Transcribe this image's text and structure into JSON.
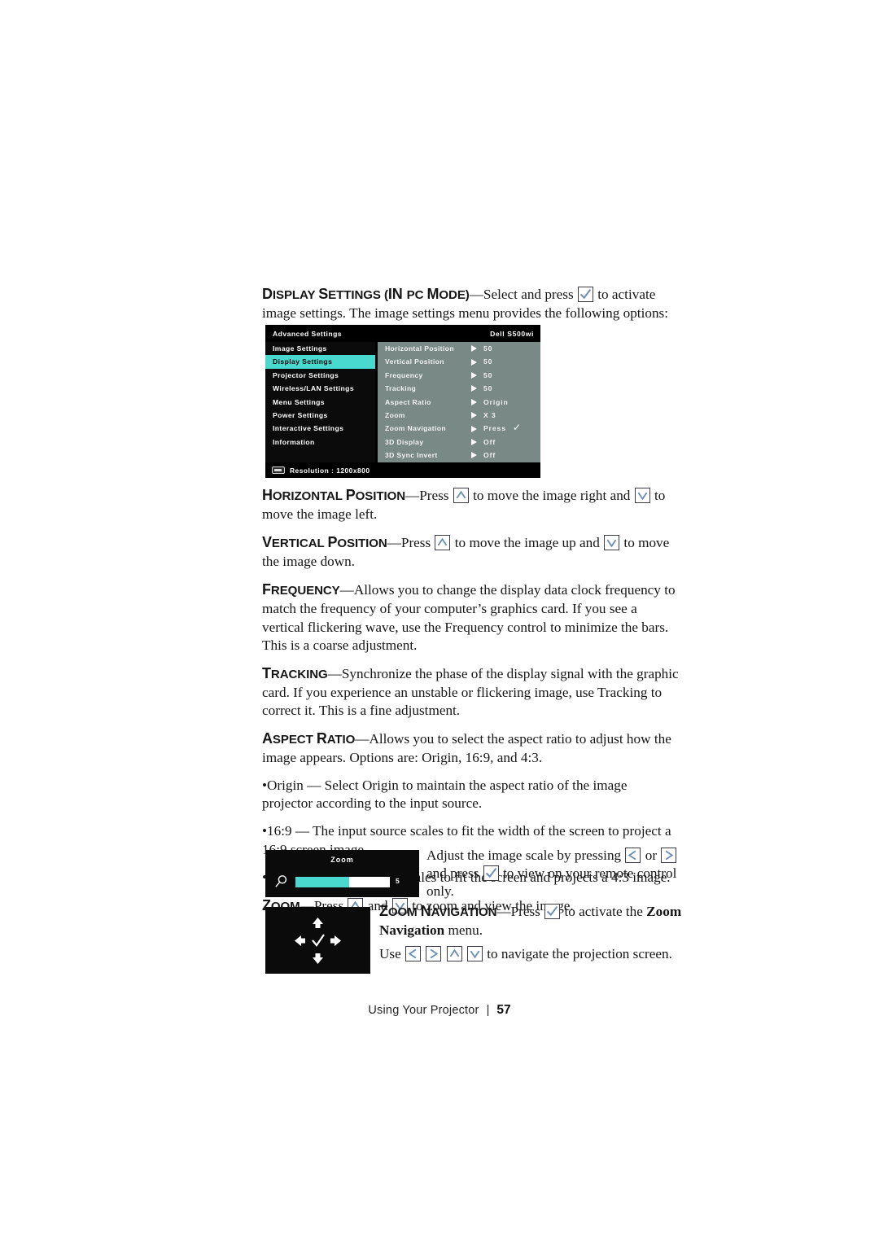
{
  "page": {
    "footer_chapter": "Using Your Projector",
    "footer_separator": "|",
    "footer_page_number": "57"
  },
  "intro": {
    "term_lead": "D",
    "term_rest": "ISPLAY ",
    "term_lead2": "S",
    "term_rest2": "ETTINGS (",
    "term_lead3": "IN ",
    "term_rest3": "PC M",
    "term_rest4": "ODE)",
    "term_full": "DISPLAY SETTINGS (IN PC MODE)",
    "text_before_key": "—Select and press",
    "text_after_key": "to activate image settings. The image settings menu provides the following options:"
  },
  "osd": {
    "title": "Advanced Settings",
    "model": "Dell  S500wi",
    "left_items": [
      {
        "label": "Image Settings",
        "selected": false
      },
      {
        "label": "Display Settings",
        "selected": true
      },
      {
        "label": "Projector Settings",
        "selected": false
      },
      {
        "label": "Wireless/LAN Settings",
        "selected": false
      },
      {
        "label": "Menu Settings",
        "selected": false
      },
      {
        "label": "Power Settings",
        "selected": false
      },
      {
        "label": "Interactive Settings",
        "selected": false
      },
      {
        "label": "Information",
        "selected": false
      }
    ],
    "rows": [
      {
        "label": "Horizontal Position",
        "value": "50",
        "check": ""
      },
      {
        "label": "Vertical Position",
        "value": "50",
        "check": ""
      },
      {
        "label": "Frequency",
        "value": "50",
        "check": ""
      },
      {
        "label": "Tracking",
        "value": "50",
        "check": ""
      },
      {
        "label": "Aspect Ratio",
        "value": "Origin",
        "check": ""
      },
      {
        "label": "Zoom",
        "value": "X 3",
        "check": ""
      },
      {
        "label": "Zoom Navigation",
        "value": "Press",
        "check": "✓"
      },
      {
        "label": "3D Display",
        "value": "Off",
        "check": ""
      },
      {
        "label": "3D Sync Invert",
        "value": "Off",
        "check": ""
      }
    ],
    "footer_label": "Resolution : 1200x800",
    "colors": {
      "highlight": "#4ad9cf",
      "panel_bg": "#788986",
      "menu_bg": "#000000"
    }
  },
  "sections": {
    "horizontal_position": {
      "term": "HORIZONTAL POSITION",
      "t1": "—Press",
      "t2": "to move the image right and",
      "t3": "to move the image left."
    },
    "vertical_position": {
      "term": "VERTICAL POSITION",
      "t1": "—Press",
      "t2": "to move the image up and",
      "t3": "to move the image down."
    },
    "frequency": {
      "term": "FREQUENCY",
      "body": "—Allows you to change the display data clock frequency to match the frequency of your computer’s graphics card. If you see a vertical flickering wave, use the Frequency control to minimize the bars. This is a coarse adjustment."
    },
    "tracking": {
      "term": "TRACKING",
      "body": "—Synchronize the phase of the display signal with the graphic card. If you experience an unstable or flickering image, use Tracking to correct it. This is a fine adjustment."
    },
    "aspect_ratio": {
      "term": "ASPECT RATIO",
      "body": "—Allows you to select the aspect ratio to adjust how the image appears. Options are: Origin, 16:9, and 4:3.",
      "bullets": [
        "•Origin — Select Origin to maintain the aspect ratio of the image projector according to the input source.",
        "•16:9 — The input source scales to fit the width of the screen to project a 16:9 screen image.",
        "•4:3 — The input source scales to fit the screen and projects a 4:3 image."
      ]
    },
    "zoom": {
      "term": "ZOOM",
      "t1": "—Press",
      "t2": "and",
      "t3": "to zoom and view the image.",
      "side_t1": "Adjust the image scale by pressing",
      "side_t2": "or",
      "side_t3": "and press",
      "side_t4": "to view on your remote control only."
    },
    "zoom_navigation": {
      "term": "ZOOM NAVIGATION",
      "t1": "—Press",
      "t2": "to activate the",
      "bold1": "Zoom Navigation",
      "t3": "menu.",
      "t4": "Use",
      "t5": "to navigate the projection screen."
    }
  },
  "zoom_widget": {
    "title": "Zoom",
    "value": "5",
    "fill_percent": 57,
    "icon": "magnifier-icon"
  },
  "nav_widget": {
    "up": "up-arrow-icon",
    "down": "down-arrow-icon",
    "left": "left-arrow-icon",
    "right": "right-arrow-icon",
    "center": "check-icon"
  },
  "key_icons": {
    "check": "check-key-icon",
    "up": "up-key-icon",
    "down": "down-key-icon",
    "left": "left-key-icon",
    "right": "right-key-icon"
  }
}
